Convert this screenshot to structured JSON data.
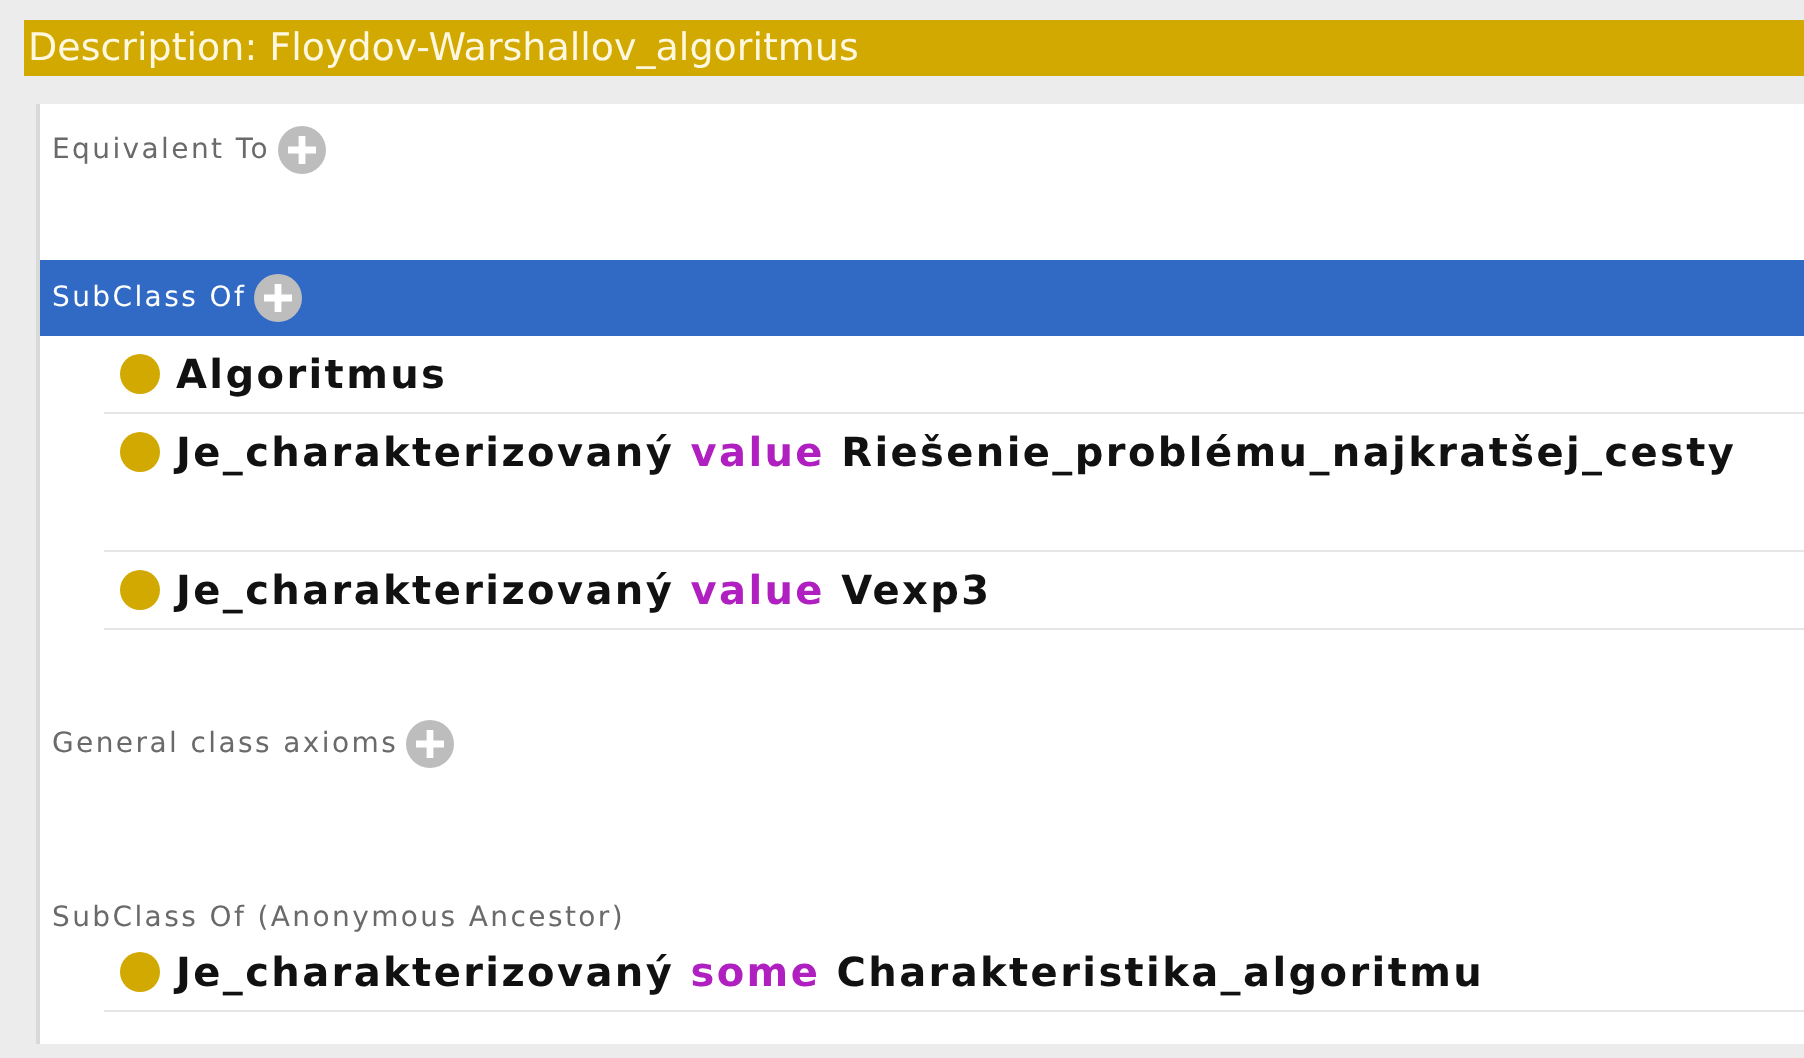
{
  "title": "Description: Floydov-Warshallov_algoritmus",
  "sections": [
    {
      "title": "Equivalent To",
      "selected": false,
      "addable": true
    },
    {
      "title": "SubClass Of",
      "selected": true,
      "addable": true,
      "rows": [
        {
          "tall": false,
          "parts": [
            {
              "kind": "entity",
              "text": "Algoritmus"
            }
          ]
        },
        {
          "tall": true,
          "parts": [
            {
              "kind": "entity",
              "text": "Je_charakterizovaný"
            },
            {
              "kind": "keyword",
              "text": "value"
            },
            {
              "kind": "entity",
              "text": "Riešenie_problému_najkratšej_cesty"
            }
          ]
        },
        {
          "tall": false,
          "parts": [
            {
              "kind": "entity",
              "text": "Je_charakterizovaný"
            },
            {
              "kind": "keyword",
              "text": "value"
            },
            {
              "kind": "entity",
              "text": "Vexp3"
            }
          ]
        }
      ]
    },
    {
      "title": "General class axioms",
      "selected": false,
      "addable": true
    },
    {
      "title": "SubClass Of (Anonymous Ancestor)",
      "selected": false,
      "addable": false,
      "rows": [
        {
          "tall": false,
          "parts": [
            {
              "kind": "entity",
              "text": "Je_charakterizovaný"
            },
            {
              "kind": "keyword",
              "text": "some"
            },
            {
              "kind": "entity",
              "text": "Charakteristika_algoritmu"
            }
          ]
        }
      ]
    }
  ]
}
